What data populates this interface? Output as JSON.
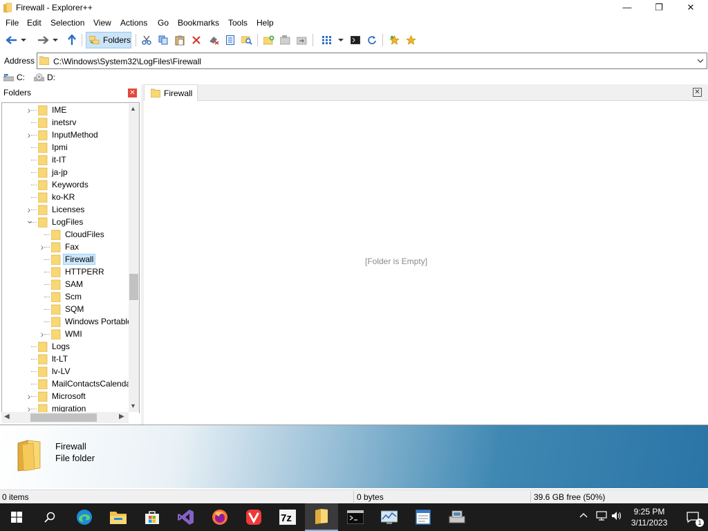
{
  "window": {
    "title": "Firewall - Explorer++",
    "min_glyph": "—",
    "max_glyph": "❐",
    "close_glyph": "✕"
  },
  "menu": [
    "File",
    "Edit",
    "Selection",
    "View",
    "Actions",
    "Go",
    "Bookmarks",
    "Tools",
    "Help"
  ],
  "toolbar": {
    "folders_label": "Folders"
  },
  "address": {
    "label": "Address",
    "path": "C:\\Windows\\System32\\LogFiles\\Firewall"
  },
  "drives": [
    "C:",
    "D:"
  ],
  "folders_pane": {
    "title": "Folders",
    "tree": [
      {
        "label": "IME",
        "level": 0,
        "expander": "collapsed"
      },
      {
        "label": "inetsrv",
        "level": 0,
        "expander": "none"
      },
      {
        "label": "InputMethod",
        "level": 0,
        "expander": "collapsed"
      },
      {
        "label": "Ipmi",
        "level": 0,
        "expander": "none"
      },
      {
        "label": "it-IT",
        "level": 0,
        "expander": "none"
      },
      {
        "label": "ja-jp",
        "level": 0,
        "expander": "none"
      },
      {
        "label": "Keywords",
        "level": 0,
        "expander": "none"
      },
      {
        "label": "ko-KR",
        "level": 0,
        "expander": "none"
      },
      {
        "label": "Licenses",
        "level": 0,
        "expander": "collapsed"
      },
      {
        "label": "LogFiles",
        "level": 0,
        "expander": "expanded"
      },
      {
        "label": "CloudFiles",
        "level": 1,
        "expander": "none"
      },
      {
        "label": "Fax",
        "level": 1,
        "expander": "collapsed"
      },
      {
        "label": "Firewall",
        "level": 1,
        "expander": "none",
        "selected": true
      },
      {
        "label": "HTTPERR",
        "level": 1,
        "expander": "none"
      },
      {
        "label": "SAM",
        "level": 1,
        "expander": "none"
      },
      {
        "label": "Scm",
        "level": 1,
        "expander": "none"
      },
      {
        "label": "SQM",
        "level": 1,
        "expander": "none"
      },
      {
        "label": "Windows Portable",
        "level": 1,
        "expander": "none"
      },
      {
        "label": "WMI",
        "level": 1,
        "expander": "collapsed"
      },
      {
        "label": "Logs",
        "level": 0,
        "expander": "none"
      },
      {
        "label": "lt-LT",
        "level": 0,
        "expander": "none"
      },
      {
        "label": "lv-LV",
        "level": 0,
        "expander": "none"
      },
      {
        "label": "MailContactsCalenda",
        "level": 0,
        "expander": "none"
      },
      {
        "label": "Microsoft",
        "level": 0,
        "expander": "collapsed"
      },
      {
        "label": "migration",
        "level": 0,
        "expander": "collapsed"
      }
    ]
  },
  "tab": {
    "label": "Firewall",
    "close_glyph": "✕"
  },
  "listview": {
    "empty_message": "[Folder is Empty]"
  },
  "display_window": {
    "name": "Firewall",
    "type": "File folder"
  },
  "status": {
    "items": "0 items",
    "size": "0 bytes",
    "free": "39.6 GB free (50%)"
  },
  "taskbar": {
    "time": "9:25 PM",
    "date": "3/11/2023",
    "notification_count": "1",
    "apps": [
      "start",
      "search",
      "edge",
      "file-explorer",
      "store",
      "visual-studio",
      "firefox",
      "vivaldi",
      "7zip",
      "explorerpp",
      "terminal",
      "monitor",
      "notepad",
      "network-tool"
    ],
    "active_app": "explorerpp"
  },
  "colors": {
    "accent_selected": "#cce8ff",
    "folder_yellow": "#f8d775",
    "taskbar": "#1c1c1c",
    "close_red": "#e04a3a"
  }
}
